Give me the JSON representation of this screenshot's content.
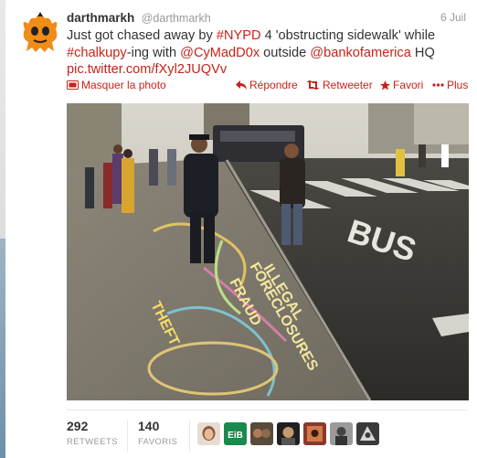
{
  "tweet": {
    "fullname": "darthmarkh",
    "username": "@darthmarkh",
    "timestamp": "6 Juil",
    "text": {
      "t1": "Just got chased away by ",
      "hashtag_nypd": "#NYPD",
      "t2": " 4 'obstructing sidewalk' while",
      "hashtag_chalkupy": "#chalkupy",
      "t3": "-ing with ",
      "mention_cymad": "@CyMadD0x",
      "t4": " outside ",
      "mention_boa": "@bankofamerica",
      "t5": " HQ",
      "pic_link": "pic.twitter.com/fXyl2JUQVv"
    }
  },
  "actions": {
    "hide_photo": "Masquer la photo",
    "reply": "Répondre",
    "retweet": "Retweeter",
    "favorite": "Favori",
    "more": "Plus"
  },
  "photo": {
    "bus_lane_text": "BUS",
    "chalk_lines": [
      "ILLEGAL",
      "FORECLOSURES",
      "FRAUD",
      "THEFT"
    ]
  },
  "stats": {
    "retweets_count": "292",
    "retweets_label": "RETWEETS",
    "favorites_count": "140",
    "favorites_label": "FAVORIS"
  },
  "favoriters_count_shown": 7,
  "colors": {
    "link": "#c8221a",
    "avatar_orange": "#f08c18",
    "text": "#333333",
    "muted": "#999999"
  },
  "icons": [
    "hide-photo-icon",
    "reply-icon",
    "retweet-icon",
    "star-icon",
    "more-icon"
  ]
}
